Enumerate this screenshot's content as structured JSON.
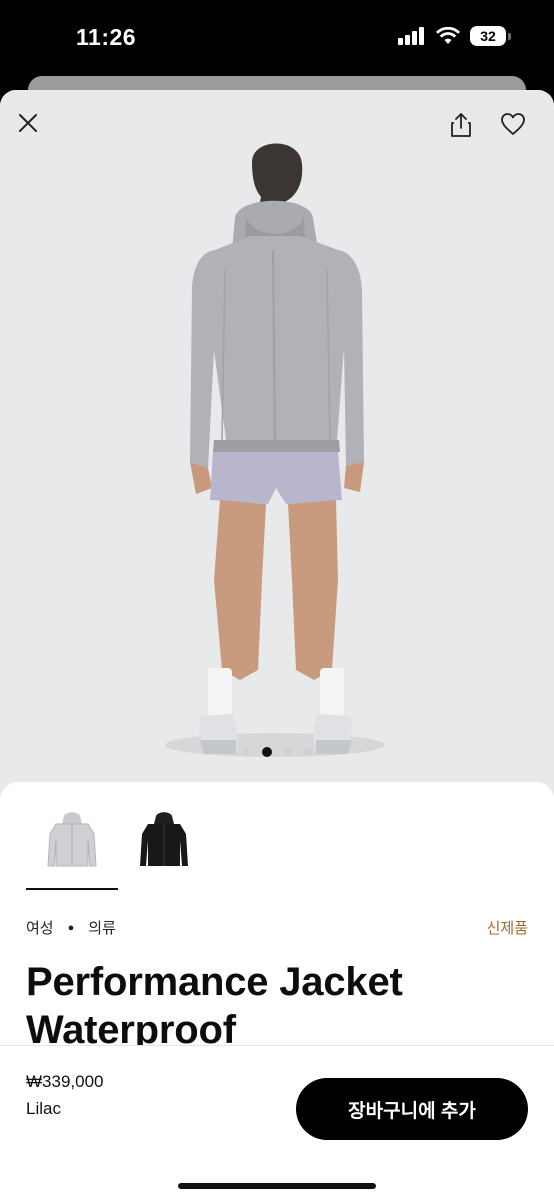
{
  "status": {
    "time": "11:26",
    "battery": "32"
  },
  "hero": {
    "close_icon": "close-icon",
    "share_icon": "share-icon",
    "favorite_icon": "heart-icon",
    "image_count": 4,
    "active_image": 2,
    "image": "woman-back-grey-jacket"
  },
  "colors": {
    "accent": "#a06a2a",
    "primary_button": "#000000",
    "hero_bg": "#e8e9ea"
  },
  "variants": [
    {
      "name": "Lilac",
      "selected": true
    },
    {
      "name": "Black",
      "selected": false
    }
  ],
  "product": {
    "gender": "여성",
    "category": "의류",
    "badge": "신제품",
    "title": "Performance Jacket Waterproof",
    "price": "₩339,000",
    "color": "Lilac"
  },
  "actions": {
    "add_to_cart": "장바구니에 추가"
  }
}
